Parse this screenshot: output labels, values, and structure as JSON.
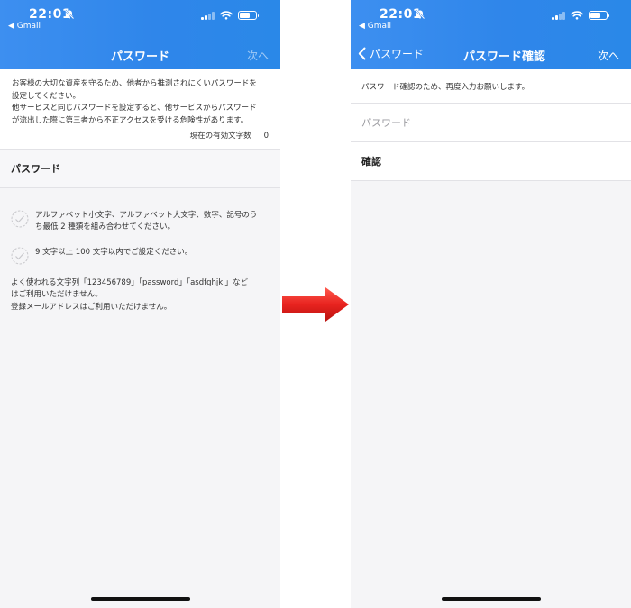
{
  "status_bar": {
    "time": "22:01",
    "back_app": "◀ Gmail"
  },
  "left_screen": {
    "title": "パスワード",
    "next_label": "次へ",
    "intro_lines": [
      "お客様の大切な資産を守るため、他者から推測されにくいパスワードを",
      "設定してください。",
      "他サービスと同じパスワードを設定すると、他サービスからパスワード",
      "が流出した際に第三者から不正アクセスを受ける危険性があります。"
    ],
    "char_count_label": "現在の有効文字数",
    "char_count_value": "0",
    "password_label": "パスワード",
    "rules": [
      {
        "line1": "アルファベット小文字、アルファベット大文字、数字、記号のう",
        "line2": "ち最低 2 種類を組み合わせてください。"
      },
      {
        "line1": "9 文字以上 100 文字以内でご設定ください。",
        "line2": ""
      }
    ],
    "notes": [
      "よく使われる文字列「123456789」「password」「asdfghjkl」など",
      "はご利用いただけません。",
      "登録メールアドレスはご利用いただけません。"
    ]
  },
  "right_screen": {
    "back_label": "パスワード",
    "title": "パスワード確認",
    "next_label": "次へ",
    "description": "パスワード確認のため、再度入力お願いします。",
    "password_placeholder": "パスワード",
    "confirm_label": "確認"
  },
  "colors": {
    "header_blue": "#2f86ea",
    "arrow_red": "#e8231f"
  }
}
